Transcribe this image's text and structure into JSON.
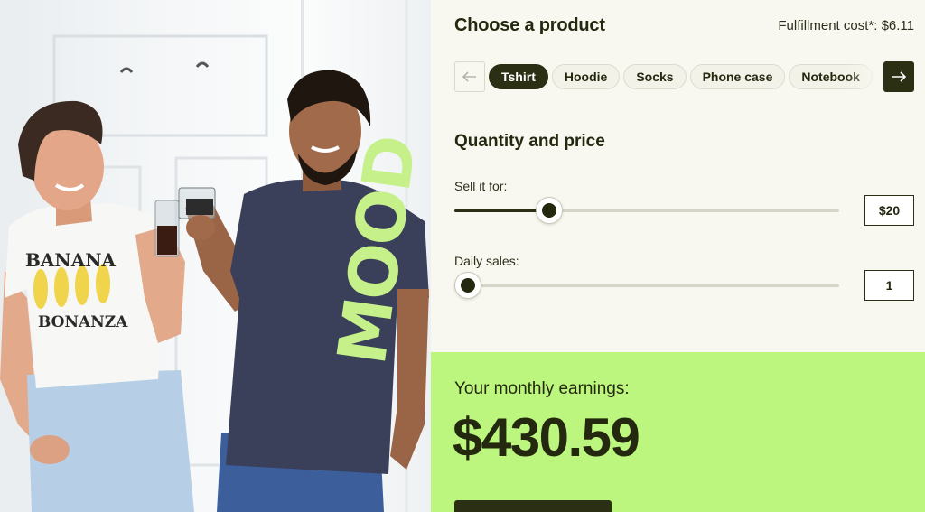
{
  "product_section": {
    "title": "Choose a product",
    "fulfillment_cost": "Fulfillment cost*: $6.11",
    "products": [
      "Tshirt",
      "Hoodie",
      "Socks",
      "Phone case",
      "Notebook"
    ],
    "selected_product": "Tshirt",
    "prev_icon": "arrow-left-icon",
    "next_icon": "arrow-right-icon"
  },
  "quantity_section": {
    "title": "Quantity and price",
    "price": {
      "label": "Sell it for:",
      "value": "$20",
      "slider_fraction": 0.22
    },
    "sales": {
      "label": "Daily sales:",
      "value": "1",
      "slider_fraction": 0.0
    }
  },
  "earnings": {
    "label": "Your monthly earnings:",
    "value": "$430.59"
  },
  "photo": {
    "shirt_left_text_top": "BANANA",
    "shirt_left_text_bottom": "BONANZA",
    "shirt_right_text": "MOOD"
  },
  "colors": {
    "accent_green": "#bdf67e",
    "dark": "#2b2f14",
    "panel_bg": "#f9f8f0",
    "shirt_print": "#c5f08a"
  }
}
